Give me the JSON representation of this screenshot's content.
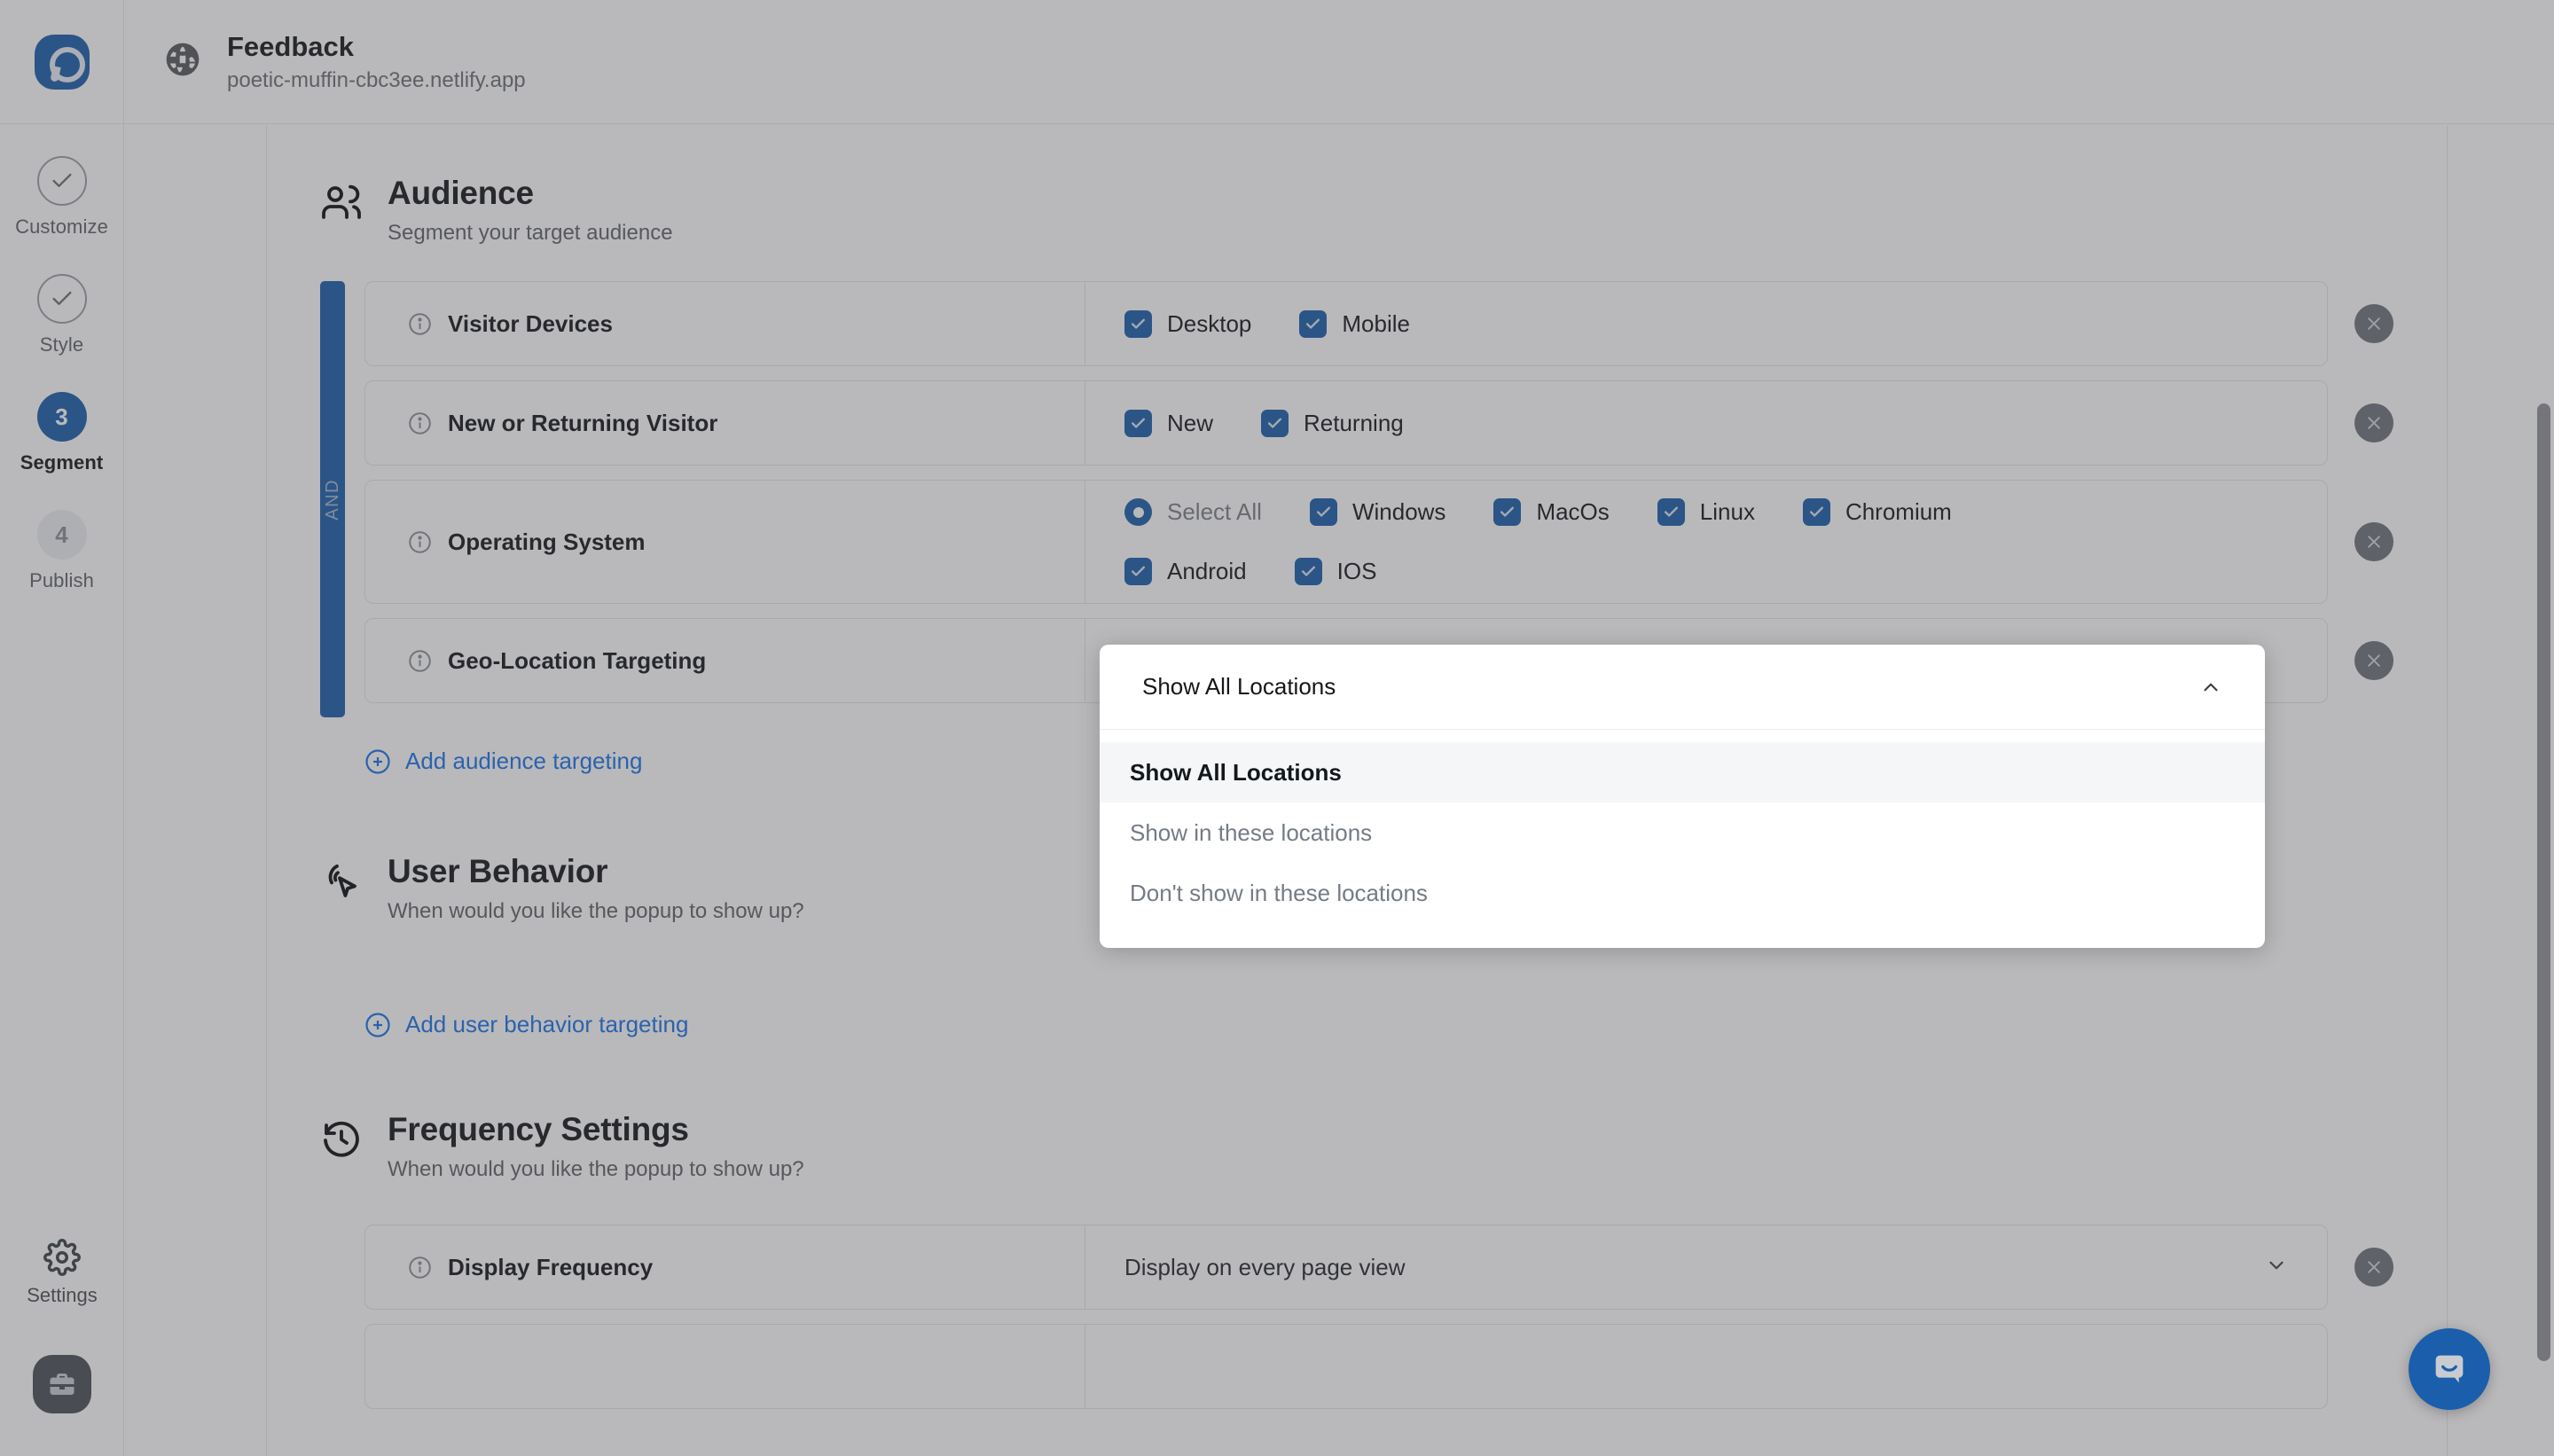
{
  "brand": {
    "accent": "#1b5eac",
    "link": "#1a73e8",
    "logo_alt": "popupsmart-logo"
  },
  "topbar": {
    "site_title": "Feedback",
    "site_url": "poetic-muffin-cbc3ee.netlify.app",
    "globe_icon": "globe-icon"
  },
  "sidebar": {
    "steps": [
      {
        "label": "Customize",
        "state": "done",
        "marker": "check"
      },
      {
        "label": "Style",
        "state": "done",
        "marker": "check"
      },
      {
        "label": "Segment",
        "state": "active",
        "marker": "3"
      },
      {
        "label": "Publish",
        "state": "idle",
        "marker": "4"
      }
    ],
    "settings_label": "Settings",
    "settings_icon": "gear-icon",
    "workspace_icon": "briefcase-icon"
  },
  "audience": {
    "title": "Audience",
    "subtitle": "Segment your target audience",
    "icon": "people-icon",
    "group_operator": "AND",
    "add_link": "Add audience targeting",
    "rules": [
      {
        "label": "Visitor Devices",
        "type": "checkboxes",
        "options": [
          {
            "label": "Desktop",
            "control": "checkbox",
            "checked": true
          },
          {
            "label": "Mobile",
            "control": "checkbox",
            "checked": true
          }
        ]
      },
      {
        "label": "New or Returning Visitor",
        "type": "checkboxes",
        "options": [
          {
            "label": "New",
            "control": "checkbox",
            "checked": true
          },
          {
            "label": "Returning",
            "control": "checkbox",
            "checked": true
          }
        ]
      },
      {
        "label": "Operating System",
        "type": "checkboxes",
        "options": [
          {
            "label": "Select All",
            "control": "radio",
            "checked": true,
            "muted": true
          },
          {
            "label": "Windows",
            "control": "checkbox",
            "checked": true
          },
          {
            "label": "MacOs",
            "control": "checkbox",
            "checked": true
          },
          {
            "label": "Linux",
            "control": "checkbox",
            "checked": true
          },
          {
            "label": "Chromium",
            "control": "checkbox",
            "checked": true
          },
          {
            "label": "Android",
            "control": "checkbox",
            "checked": true
          },
          {
            "label": "IOS",
            "control": "checkbox",
            "checked": true
          }
        ]
      },
      {
        "label": "Geo-Location Targeting",
        "type": "select",
        "value": "Show All Locations"
      }
    ]
  },
  "user_behavior": {
    "title": "User Behavior",
    "subtitle": "When would you like the popup to show up?",
    "icon": "cursor-click-icon",
    "add_link": "Add user behavior targeting"
  },
  "frequency": {
    "title": "Frequency Settings",
    "subtitle": "When would you like the popup to show up?",
    "icon": "history-icon",
    "rules": [
      {
        "label": "Display Frequency",
        "type": "select",
        "value": "Display on every page view"
      }
    ]
  },
  "dropdown": {
    "open": true,
    "input_value": "Show All Locations",
    "caret_icon": "chevron-up-icon",
    "options": [
      {
        "label": "Show All Locations",
        "selected": true
      },
      {
        "label": "Show in these locations",
        "selected": false
      },
      {
        "label": "Don't show in these locations",
        "selected": false
      }
    ]
  },
  "intercom": {
    "icon": "chat-bubble-icon"
  },
  "remove_icon": "close-icon"
}
